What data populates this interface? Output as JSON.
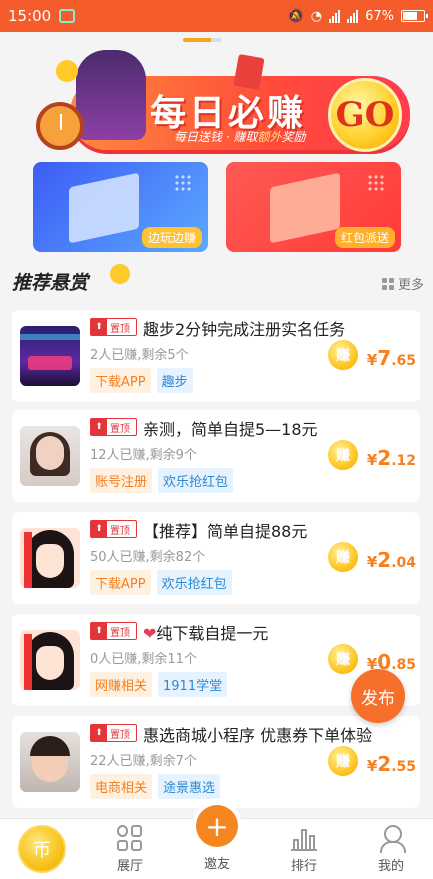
{
  "status_bar": {
    "time": "15:00",
    "battery": "67%",
    "icons": [
      "screenshot-icon",
      "mute-icon",
      "wifi-icon",
      "signal-icon",
      "signal-icon",
      "battery-icon"
    ]
  },
  "banner": {
    "title": "每日必赚",
    "subtitle_prefix": "每日送钱 · 赚取",
    "subtitle_highlight": "额外",
    "subtitle_suffix": "奖励",
    "go": "GO"
  },
  "feature_cards": [
    {
      "label": "边玩边赚"
    },
    {
      "label": "红包派送"
    }
  ],
  "section": {
    "title": "推荐悬赏",
    "more": "更多"
  },
  "tasks": [
    {
      "pin": "置顶",
      "title": "趣步2分钟完成注册实名任务",
      "meta": "2人已赚,剩余5个",
      "tags": [
        "下载APP",
        "趣步"
      ],
      "earn": "赚",
      "currency": "¥",
      "price_int": "7",
      "price_dec": ".65"
    },
    {
      "pin": "置顶",
      "title": "亲测，简单自提5—18元",
      "meta": "12人已赚,剩余9个",
      "tags": [
        "账号注册",
        "欢乐抢红包"
      ],
      "earn": "赚",
      "currency": "¥",
      "price_int": "2",
      "price_dec": ".12"
    },
    {
      "pin": "置顶",
      "title": "【推荐】简单自提88元",
      "meta": "50人已赚,剩余82个",
      "tags": [
        "下载APP",
        "欢乐抢红包"
      ],
      "earn": "赚",
      "currency": "¥",
      "price_int": "2",
      "price_dec": ".04"
    },
    {
      "pin": "置顶",
      "heart": "❤",
      "title": "纯下载自提一元",
      "meta": "0人已赚,剩余11个",
      "tags": [
        "网赚相关",
        "1911学堂"
      ],
      "earn": "赚",
      "currency": "¥",
      "price_int": "0",
      "price_dec": ".85"
    },
    {
      "pin": "置顶",
      "title": "惠选商城小程序 优惠券下单体验",
      "meta": "22人已赚,剩余7个",
      "tags": [
        "电商相关",
        "途景惠选"
      ],
      "earn": "赚",
      "currency": "¥",
      "price_int": "2",
      "price_dec": ".55"
    }
  ],
  "fab": {
    "label": "发布"
  },
  "bottom_nav": {
    "coin": "币",
    "hall": "展厅",
    "plus": "+",
    "friends": "邀友",
    "rank": "排行",
    "me": "我的"
  },
  "colors": {
    "accent": "#f45c2c",
    "price": "#f5801f",
    "pin": "#e3353a"
  }
}
